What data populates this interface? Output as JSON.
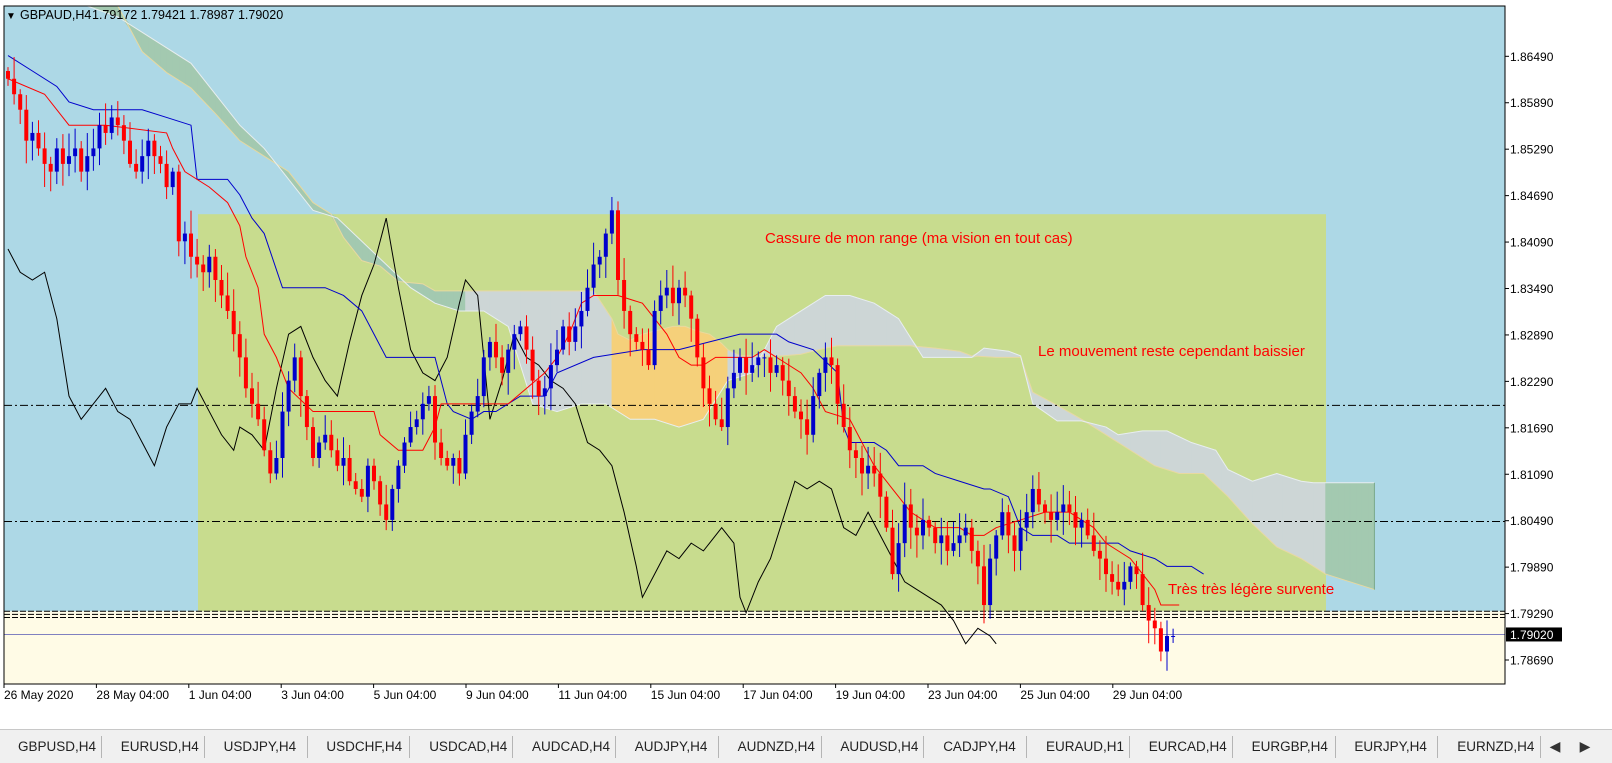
{
  "header": {
    "symbol": "GBPAUD,H4",
    "ohlc": "1.79172 1.79421 1.78987 1.79020"
  },
  "colors": {
    "background": "#add8e6",
    "range_box": "#c8dc8e",
    "cloud_bear": "#cdd6d6",
    "cloud_bull_left": "#a3c9b0",
    "cloud_bull_orange": "#f5d07a",
    "oversold_zone": "#fffbe6",
    "bull_candle": "#0000cc",
    "bear_candle": "#ff0000",
    "tenkan": "#ff0000",
    "kijun": "#0000cc",
    "chikou": "#000000",
    "annotation": "#ff0000",
    "price_tag": "#000000"
  },
  "chart_data": {
    "type": "candlestick",
    "symbol": "GBPAUD",
    "timeframe": "H4",
    "y_ticks": [
      "1.86490",
      "1.85890",
      "1.85290",
      "1.84690",
      "1.84090",
      "1.83490",
      "1.82890",
      "1.82290",
      "1.81690",
      "1.81090",
      "1.80490",
      "1.79890",
      "1.79290",
      "1.78690"
    ],
    "ylim": [
      1.7838,
      1.8714
    ],
    "x_ticks": [
      "26 May 2020",
      "28 May 04:00",
      "1 Jun 04:00",
      "3 Jun 04:00",
      "5 Jun 04:00",
      "9 Jun 04:00",
      "11 Jun 04:00",
      "15 Jun 04:00",
      "17 Jun 04:00",
      "19 Jun 04:00",
      "23 Jun 04:00",
      "25 Jun 04:00",
      "29 Jun 04:00"
    ],
    "current_price": "1.79020",
    "horizontal_lines": [
      1.8198,
      1.8048,
      1.7932,
      1.7928,
      1.7924
    ],
    "annotations": [
      "Cassure de mon range (ma vision en tout cas)",
      "Le mouvement reste cependant baissier",
      "Très très légère survente"
    ],
    "closes": [
      1.862,
      1.86,
      1.858,
      1.854,
      1.855,
      1.853,
      1.851,
      1.85,
      1.853,
      1.851,
      1.852,
      1.853,
      1.85,
      1.852,
      1.853,
      1.856,
      1.855,
      1.857,
      1.856,
      1.854,
      1.851,
      1.85,
      1.852,
      1.854,
      1.852,
      1.851,
      1.848,
      1.85,
      1.841,
      1.842,
      1.839,
      1.838,
      1.837,
      1.839,
      1.836,
      1.834,
      1.832,
      1.829,
      1.826,
      1.822,
      1.82,
      1.818,
      1.814,
      1.811,
      1.813,
      1.819,
      1.823,
      1.826,
      1.821,
      1.817,
      1.813,
      1.815,
      1.816,
      1.814,
      1.812,
      1.813,
      1.81,
      1.809,
      1.808,
      1.812,
      1.81,
      1.807,
      1.805,
      1.809,
      1.812,
      1.815,
      1.817,
      1.818,
      1.82,
      1.821,
      1.815,
      1.813,
      1.812,
      1.813,
      1.811,
      1.816,
      1.819,
      1.821,
      1.826,
      1.828,
      1.826,
      1.824,
      1.827,
      1.829,
      1.83,
      1.827,
      1.823,
      1.821,
      1.822,
      1.825,
      1.827,
      1.83,
      1.828,
      1.83,
      1.832,
      1.835,
      1.838,
      1.839,
      1.842,
      1.845,
      1.836,
      1.832,
      1.829,
      1.828,
      1.827,
      1.825,
      1.832,
      1.834,
      1.835,
      1.833,
      1.835,
      1.834,
      1.831,
      1.826,
      1.822,
      1.82,
      1.818,
      1.817,
      1.822,
      1.824,
      1.826,
      1.824,
      1.825,
      1.826,
      1.826,
      1.824,
      1.825,
      1.823,
      1.821,
      1.819,
      1.818,
      1.816,
      1.821,
      1.824,
      1.826,
      1.825,
      1.82,
      1.817,
      1.814,
      1.813,
      1.811,
      1.812,
      1.811,
      1.808,
      1.804,
      1.798,
      1.802,
      1.807,
      1.804,
      1.803,
      1.805,
      1.804,
      1.802,
      1.803,
      1.801,
      1.802,
      1.803,
      1.804,
      1.801,
      1.799,
      1.794,
      1.8,
      1.803,
      1.806,
      1.803,
      1.801,
      1.804,
      1.806,
      1.809,
      1.807,
      1.806,
      1.805,
      1.806,
      1.807,
      1.806,
      1.804,
      1.805,
      1.803,
      1.801,
      1.8,
      1.798,
      1.797,
      1.796,
      1.797,
      1.799,
      1.798,
      1.794,
      1.792,
      1.791,
      1.788,
      1.79,
      1.79
    ],
    "tenkan_pts": [
      [
        0,
        1.862
      ],
      [
        6,
        1.86
      ],
      [
        10,
        1.856
      ],
      [
        16,
        1.856
      ],
      [
        26,
        1.855
      ],
      [
        27,
        1.853
      ],
      [
        29,
        1.85
      ],
      [
        33,
        1.848
      ],
      [
        36,
        1.846
      ],
      [
        38,
        1.843
      ],
      [
        39,
        1.839
      ],
      [
        41,
        1.835
      ],
      [
        42,
        1.829
      ],
      [
        44,
        1.826
      ],
      [
        46,
        1.822
      ],
      [
        50,
        1.819
      ],
      [
        56,
        1.819
      ],
      [
        60,
        1.819
      ],
      [
        61,
        1.816
      ],
      [
        64,
        1.814
      ],
      [
        68,
        1.814
      ],
      [
        70,
        1.817
      ],
      [
        71,
        1.82
      ],
      [
        74,
        1.82
      ],
      [
        77,
        1.82
      ],
      [
        82,
        1.82
      ],
      [
        85,
        1.822
      ],
      [
        88,
        1.824
      ],
      [
        90,
        1.826
      ],
      [
        92,
        1.829
      ],
      [
        94,
        1.833
      ],
      [
        96,
        1.834
      ],
      [
        100,
        1.834
      ],
      [
        104,
        1.833
      ],
      [
        108,
        1.829
      ],
      [
        110,
        1.826
      ],
      [
        112,
        1.825
      ],
      [
        114,
        1.825
      ],
      [
        116,
        1.826
      ],
      [
        118,
        1.826
      ],
      [
        122,
        1.826
      ],
      [
        124,
        1.827
      ],
      [
        126,
        1.826
      ],
      [
        130,
        1.824
      ],
      [
        132,
        1.822
      ],
      [
        134,
        1.819
      ],
      [
        138,
        1.818
      ],
      [
        140,
        1.815
      ],
      [
        142,
        1.812
      ],
      [
        144,
        1.81
      ],
      [
        146,
        1.808
      ],
      [
        148,
        1.806
      ],
      [
        150,
        1.805
      ],
      [
        152,
        1.804
      ],
      [
        156,
        1.804
      ],
      [
        158,
        1.803
      ],
      [
        160,
        1.803
      ],
      [
        162,
        1.804
      ],
      [
        166,
        1.805
      ],
      [
        170,
        1.806
      ],
      [
        174,
        1.806
      ],
      [
        176,
        1.805
      ],
      [
        178,
        1.804
      ],
      [
        180,
        1.802
      ],
      [
        182,
        1.801
      ],
      [
        184,
        1.8
      ],
      [
        186,
        1.798
      ],
      [
        188,
        1.796
      ],
      [
        189,
        1.794
      ],
      [
        192,
        1.794
      ]
    ],
    "kijun_pts": [
      [
        0,
        1.865
      ],
      [
        4,
        1.863
      ],
      [
        8,
        1.861
      ],
      [
        10,
        1.859
      ],
      [
        14,
        1.858
      ],
      [
        22,
        1.858
      ],
      [
        26,
        1.857
      ],
      [
        30,
        1.856
      ],
      [
        31,
        1.849
      ],
      [
        36,
        1.849
      ],
      [
        38,
        1.847
      ],
      [
        40,
        1.844
      ],
      [
        42,
        1.842
      ],
      [
        45,
        1.835
      ],
      [
        52,
        1.835
      ],
      [
        55,
        1.834
      ],
      [
        58,
        1.832
      ],
      [
        60,
        1.829
      ],
      [
        62,
        1.826
      ],
      [
        70,
        1.826
      ],
      [
        72,
        1.82
      ],
      [
        73,
        1.819
      ],
      [
        76,
        1.818
      ],
      [
        78,
        1.819
      ],
      [
        80,
        1.819
      ],
      [
        84,
        1.821
      ],
      [
        88,
        1.821
      ],
      [
        90,
        1.824
      ],
      [
        96,
        1.826
      ],
      [
        104,
        1.827
      ],
      [
        110,
        1.827
      ],
      [
        120,
        1.829
      ],
      [
        126,
        1.829
      ],
      [
        128,
        1.828
      ],
      [
        132,
        1.827
      ],
      [
        136,
        1.824
      ],
      [
        137,
        1.817
      ],
      [
        138,
        1.815
      ],
      [
        142,
        1.815
      ],
      [
        144,
        1.814
      ],
      [
        146,
        1.812
      ],
      [
        150,
        1.812
      ],
      [
        152,
        1.811
      ],
      [
        156,
        1.81
      ],
      [
        160,
        1.809
      ],
      [
        161,
        1.809
      ],
      [
        164,
        1.808
      ],
      [
        166,
        1.804
      ],
      [
        168,
        1.803
      ],
      [
        170,
        1.803
      ],
      [
        172,
        1.803
      ],
      [
        174,
        1.802
      ],
      [
        182,
        1.802
      ],
      [
        184,
        1.801
      ],
      [
        188,
        1.8
      ],
      [
        190,
        1.799
      ],
      [
        194,
        1.799
      ],
      [
        196,
        1.798
      ]
    ],
    "chikou_pts": [
      [
        0,
        1.84
      ],
      [
        2,
        1.837
      ],
      [
        4,
        1.836
      ],
      [
        6,
        1.837
      ],
      [
        8,
        1.831
      ],
      [
        10,
        1.821
      ],
      [
        12,
        1.818
      ],
      [
        14,
        1.82
      ],
      [
        16,
        1.822
      ],
      [
        18,
        1.819
      ],
      [
        20,
        1.818
      ],
      [
        22,
        1.815
      ],
      [
        24,
        1.812
      ],
      [
        26,
        1.817
      ],
      [
        28,
        1.82
      ],
      [
        30,
        1.82
      ],
      [
        31,
        1.822
      ],
      [
        33,
        1.819
      ],
      [
        35,
        1.816
      ],
      [
        37,
        1.814
      ],
      [
        38,
        1.817
      ],
      [
        40,
        1.816
      ],
      [
        42,
        1.814
      ],
      [
        44,
        1.822
      ],
      [
        46,
        1.829
      ],
      [
        48,
        1.83
      ],
      [
        50,
        1.826
      ],
      [
        52,
        1.823
      ],
      [
        54,
        1.821
      ],
      [
        56,
        1.828
      ],
      [
        58,
        1.834
      ],
      [
        60,
        1.838
      ],
      [
        62,
        1.844
      ],
      [
        64,
        1.835
      ],
      [
        66,
        1.827
      ],
      [
        68,
        1.824
      ],
      [
        70,
        1.823
      ],
      [
        72,
        1.826
      ],
      [
        74,
        1.833
      ],
      [
        75,
        1.836
      ],
      [
        77,
        1.834
      ],
      [
        79,
        1.818
      ],
      [
        81,
        1.823
      ],
      [
        83,
        1.829
      ],
      [
        85,
        1.826
      ],
      [
        87,
        1.825
      ],
      [
        89,
        1.823
      ],
      [
        91,
        1.822
      ],
      [
        93,
        1.82
      ],
      [
        95,
        1.815
      ],
      [
        97,
        1.814
      ],
      [
        99,
        1.812
      ],
      [
        101,
        1.806
      ],
      [
        103,
        1.799
      ],
      [
        104,
        1.795
      ],
      [
        106,
        1.798
      ],
      [
        108,
        1.801
      ],
      [
        110,
        1.8
      ],
      [
        112,
        1.802
      ],
      [
        114,
        1.801
      ],
      [
        115,
        1.802
      ],
      [
        117,
        1.804
      ],
      [
        119,
        1.802
      ],
      [
        120,
        1.795
      ],
      [
        121,
        1.793
      ],
      [
        123,
        1.797
      ],
      [
        125,
        1.8
      ],
      [
        127,
        1.805
      ],
      [
        129,
        1.81
      ],
      [
        131,
        1.809
      ],
      [
        133,
        1.81
      ],
      [
        135,
        1.809
      ],
      [
        137,
        1.804
      ],
      [
        139,
        1.803
      ],
      [
        141,
        1.806
      ],
      [
        143,
        1.803
      ],
      [
        145,
        1.8
      ],
      [
        147,
        1.797
      ],
      [
        149,
        1.796
      ],
      [
        151,
        1.795
      ],
      [
        153,
        1.794
      ],
      [
        155,
        1.792
      ],
      [
        157,
        1.789
      ],
      [
        159,
        1.791
      ],
      [
        161,
        1.79
      ],
      [
        162,
        1.789
      ]
    ],
    "span_a_pts": [
      [
        13,
        1.8714
      ],
      [
        18,
        1.8714
      ],
      [
        22,
        1.8655
      ],
      [
        26,
        1.8628
      ],
      [
        30,
        1.8608
      ],
      [
        34,
        1.8575
      ],
      [
        38,
        1.854
      ],
      [
        42,
        1.852
      ],
      [
        46,
        1.85
      ],
      [
        50,
        1.846
      ],
      [
        53,
        1.8445
      ],
      [
        55,
        1.8415
      ],
      [
        58,
        1.8385
      ],
      [
        61,
        1.8378
      ],
      [
        64,
        1.8358
      ],
      [
        68,
        1.8355
      ],
      [
        70,
        1.8346
      ],
      [
        72,
        1.8346
      ],
      [
        74,
        1.8346
      ],
      [
        76,
        1.8346
      ],
      [
        80,
        1.8346
      ],
      [
        84,
        1.8346
      ],
      [
        88,
        1.8346
      ],
      [
        92,
        1.8346
      ],
      [
        96,
        1.8346
      ],
      [
        99,
        1.831
      ],
      [
        100,
        1.829
      ],
      [
        102,
        1.8282
      ],
      [
        104,
        1.829
      ],
      [
        107,
        1.8296
      ],
      [
        109,
        1.83
      ],
      [
        111,
        1.83
      ],
      [
        113,
        1.8294
      ],
      [
        115,
        1.829
      ],
      [
        117,
        1.8278
      ],
      [
        118,
        1.827
      ],
      [
        120,
        1.8262
      ],
      [
        122,
        1.8262
      ],
      [
        124,
        1.8262
      ],
      [
        127,
        1.8262
      ],
      [
        130,
        1.8264
      ],
      [
        132,
        1.8268
      ],
      [
        134,
        1.8272
      ],
      [
        136,
        1.8275
      ],
      [
        140,
        1.8275
      ],
      [
        144,
        1.8275
      ],
      [
        148,
        1.8275
      ],
      [
        152,
        1.8272
      ],
      [
        156,
        1.8268
      ],
      [
        158,
        1.8262
      ],
      [
        162,
        1.826
      ],
      [
        166,
        1.826
      ],
      [
        168,
        1.8215
      ],
      [
        172,
        1.8198
      ],
      [
        176,
        1.818
      ],
      [
        180,
        1.816
      ],
      [
        184,
        1.814
      ],
      [
        188,
        1.812
      ],
      [
        192,
        1.811
      ],
      [
        196,
        1.811
      ],
      [
        200,
        1.808
      ],
      [
        204,
        1.8045
      ],
      [
        208,
        1.8015
      ],
      [
        212,
        1.8
      ],
      [
        216,
        1.798
      ],
      [
        220,
        1.797
      ],
      [
        224,
        1.796
      ]
    ],
    "span_b_pts": [
      [
        0,
        1.8714
      ],
      [
        13,
        1.8714
      ],
      [
        18,
        1.87
      ],
      [
        22,
        1.868
      ],
      [
        26,
        1.866
      ],
      [
        30,
        1.864
      ],
      [
        34,
        1.86
      ],
      [
        38,
        1.856
      ],
      [
        42,
        1.853
      ],
      [
        46,
        1.849
      ],
      [
        50,
        1.845
      ],
      [
        54,
        1.844
      ],
      [
        58,
        1.841
      ],
      [
        62,
        1.838
      ],
      [
        66,
        1.835
      ],
      [
        70,
        1.833
      ],
      [
        74,
        1.832
      ],
      [
        78,
        1.832
      ],
      [
        82,
        1.83
      ],
      [
        86,
        1.82
      ],
      [
        90,
        1.819
      ],
      [
        94,
        1.82
      ],
      [
        98,
        1.82
      ],
      [
        102,
        1.818
      ],
      [
        106,
        1.818
      ],
      [
        110,
        1.817
      ],
      [
        114,
        1.818
      ],
      [
        118,
        1.823
      ],
      [
        122,
        1.824
      ],
      [
        126,
        1.83
      ],
      [
        130,
        1.832
      ],
      [
        134,
        1.834
      ],
      [
        138,
        1.834
      ],
      [
        142,
        1.833
      ],
      [
        146,
        1.831
      ],
      [
        150,
        1.826
      ],
      [
        154,
        1.826
      ],
      [
        158,
        1.826
      ],
      [
        160,
        1.8272
      ],
      [
        164,
        1.8268
      ],
      [
        166,
        1.8262
      ],
      [
        168,
        1.82
      ],
      [
        172,
        1.8178
      ],
      [
        176,
        1.8178
      ],
      [
        180,
        1.817
      ],
      [
        182,
        1.816
      ],
      [
        186,
        1.8165
      ],
      [
        190,
        1.8165
      ],
      [
        194,
        1.815
      ],
      [
        198,
        1.814
      ],
      [
        200,
        1.8115
      ],
      [
        204,
        1.81
      ],
      [
        208,
        1.811
      ],
      [
        212,
        1.81
      ],
      [
        214,
        1.8098
      ],
      [
        216,
        1.8098
      ],
      [
        220,
        1.8098
      ],
      [
        224,
        1.8098
      ]
    ]
  },
  "tabs": [
    "GBPUSD,H4",
    "EURUSD,H4",
    "USDJPY,H4",
    "USDCHF,H4",
    "USDCAD,H4",
    "AUDCAD,H4",
    "AUDJPY,H4",
    "AUDNZD,H4",
    "AUDUSD,H4",
    "CADJPY,H4",
    "EURAUD,H1",
    "EURCAD,H4",
    "EURGBP,H4",
    "EURJPY,H4",
    "EURNZD,H4"
  ]
}
